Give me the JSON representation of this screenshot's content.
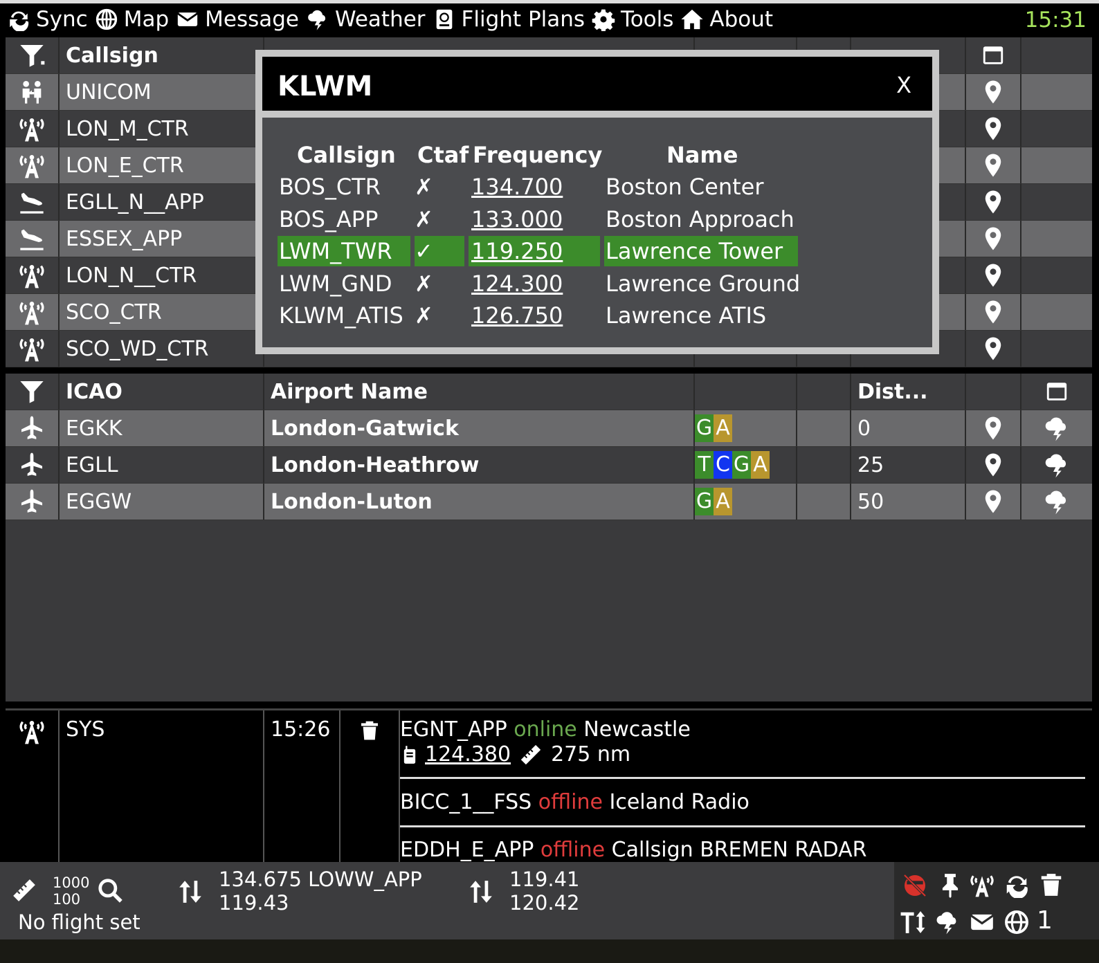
{
  "nav": {
    "items": [
      {
        "label": "Sync",
        "icon": "sync-icon"
      },
      {
        "label": "Map",
        "icon": "globe-icon"
      },
      {
        "label": "Message",
        "icon": "envelope-icon"
      },
      {
        "label": "Weather",
        "icon": "storm-cloud-icon"
      },
      {
        "label": "Flight Plans",
        "icon": "passport-icon"
      },
      {
        "label": "Tools",
        "icon": "gear-icon"
      },
      {
        "label": "About",
        "icon": "home-icon"
      }
    ],
    "clock": "15:31"
  },
  "controllers": {
    "header": {
      "callsign": "Callsign"
    },
    "rows": [
      {
        "callsign": "UNICOM",
        "icon": "users-arrows-icon"
      },
      {
        "callsign": "LON_M_CTR",
        "icon": "radio-tower-icon"
      },
      {
        "callsign": "LON_E_CTR",
        "icon": "radio-tower-icon"
      },
      {
        "callsign": "EGLL_N__APP",
        "icon": "plane-landing-icon"
      },
      {
        "callsign": "ESSEX_APP",
        "icon": "plane-landing-icon"
      },
      {
        "callsign": "LON_N__CTR",
        "icon": "radio-tower-icon"
      },
      {
        "callsign": "SCO_CTR",
        "icon": "radio-tower-icon"
      },
      {
        "callsign": "SCO_WD_CTR",
        "icon": "radio-tower-icon"
      }
    ]
  },
  "modal": {
    "title": "KLWM",
    "close": "X",
    "headers": {
      "callsign": "Callsign",
      "ctaf": "Ctaf",
      "frequency": "Frequency",
      "name": "Name"
    },
    "rows": [
      {
        "callsign": "BOS_CTR",
        "ctaf": "✗",
        "frequency": "134.700",
        "name": "Boston Center"
      },
      {
        "callsign": "BOS_APP",
        "ctaf": "✗",
        "frequency": "133.000",
        "name": "Boston Approach"
      },
      {
        "callsign": "LWM_TWR",
        "ctaf": "✓",
        "frequency": "119.250",
        "name": "Lawrence Tower"
      },
      {
        "callsign": "LWM_GND",
        "ctaf": "✗",
        "frequency": "124.300",
        "name": "Lawrence Ground"
      },
      {
        "callsign": "KLWM_ATIS",
        "ctaf": "✗",
        "frequency": "126.750",
        "name": "Lawrence ATIS"
      }
    ]
  },
  "airports": {
    "header": {
      "icao": "ICAO",
      "name": "Airport Name",
      "dist": "Dist..."
    },
    "rows": [
      {
        "icao": "EGKK",
        "name": "London-Gatwick",
        "badges": [
          "G",
          "A"
        ],
        "dist": "0"
      },
      {
        "icao": "EGLL",
        "name": "London-Heathrow",
        "badges": [
          "T",
          "C",
          "G",
          "A"
        ],
        "dist": "25"
      },
      {
        "icao": "EGGW",
        "name": "London-Luton",
        "badges": [
          "G",
          "A"
        ],
        "dist": "50"
      }
    ]
  },
  "messages": {
    "from": "SYS",
    "time": "15:26",
    "items": [
      {
        "callsign": "EGNT_APP",
        "state": "online",
        "name": "Newcastle",
        "freq": "124.380",
        "dist": "275 nm"
      },
      {
        "callsign": "BICC_1__FSS",
        "state": "offline",
        "name": "Iceland Radio"
      },
      {
        "callsign": "EDDH_E_APP",
        "state": "offline",
        "name": "Callsign BREMEN RADAR"
      }
    ]
  },
  "status": {
    "range_top": "1000",
    "range_bottom": "100",
    "flight": "No flight set",
    "com1_active": "134.675 LOWW_APP",
    "com1_standby": "119.43",
    "com2_active": "119.41",
    "com2_standby": "120.42",
    "count": "1"
  }
}
